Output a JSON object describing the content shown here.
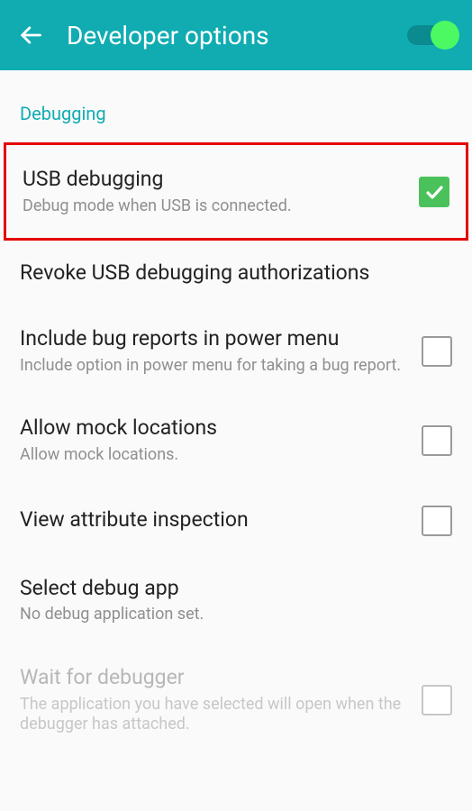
{
  "header": {
    "title": "Developer options",
    "master_switch_on": true
  },
  "section": {
    "label": "Debugging"
  },
  "items": [
    {
      "title": "USB debugging",
      "sub": "Debug mode when USB is connected.",
      "checked": true,
      "highlighted": true
    },
    {
      "title": "Revoke USB debugging authorizations",
      "sub": "",
      "no_checkbox": true
    },
    {
      "title": "Include bug reports in power menu",
      "sub": "Include option in power menu for taking a bug report.",
      "checked": false
    },
    {
      "title": "Allow mock locations",
      "sub": "Allow mock locations.",
      "checked": false
    },
    {
      "title": "View attribute inspection",
      "sub": "",
      "checked": false
    },
    {
      "title": "Select debug app",
      "sub": "No debug application set.",
      "no_checkbox": true
    },
    {
      "title": "Wait for debugger",
      "sub": "The application you have selected will open when the debugger has attached.",
      "checked": false,
      "faded": true
    }
  ]
}
